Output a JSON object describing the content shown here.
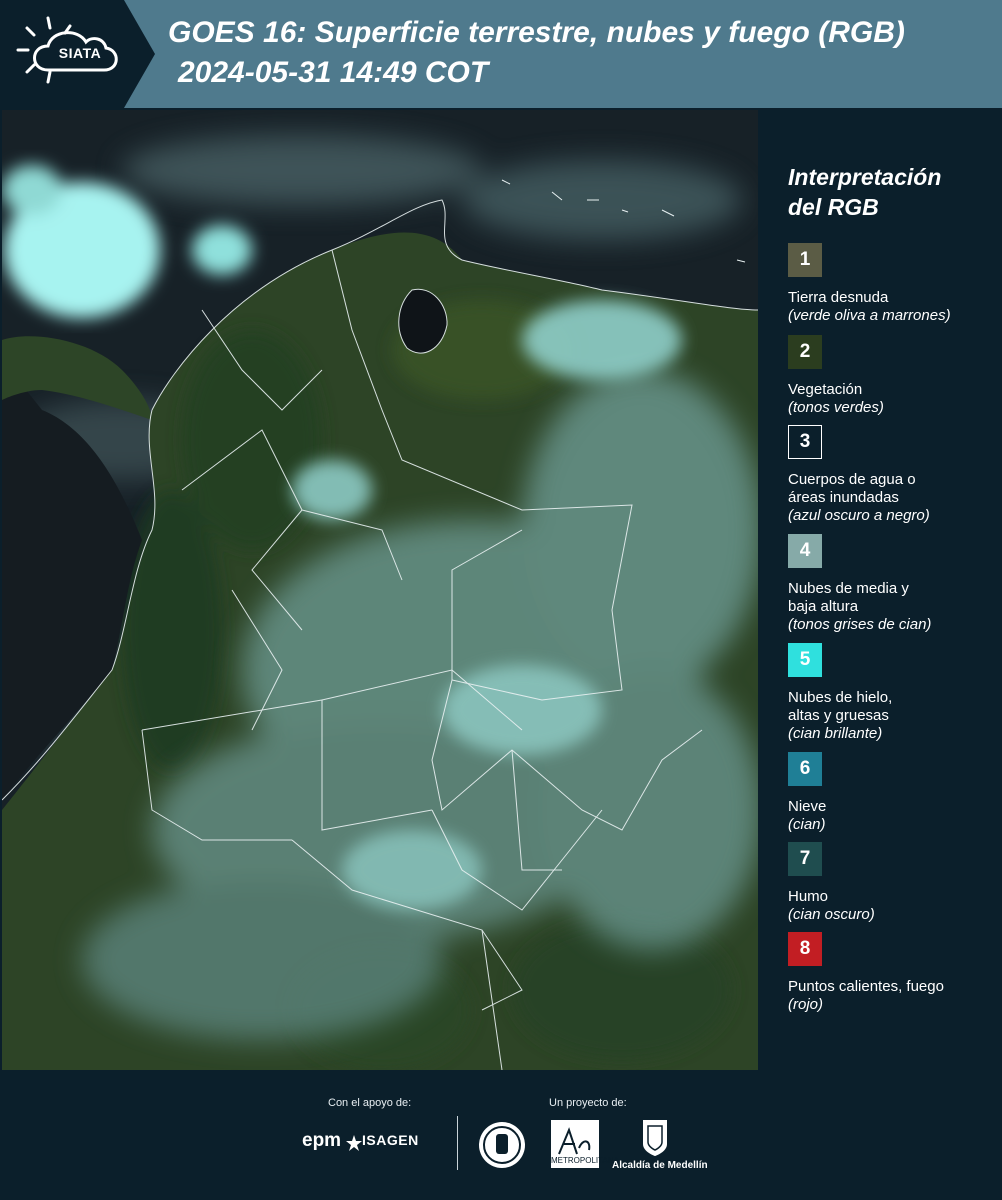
{
  "header": {
    "logo_text": "SIATA",
    "title": "GOES 16: Superficie terrestre, nubes y fuego (RGB)",
    "datetime": "2024-05-31 14:49 COT"
  },
  "legend": {
    "title_line1": "Interpretación",
    "title_line2": "del RGB",
    "items": [
      {
        "number": "1",
        "color": "#5b5c45",
        "label": "Tierra desnuda",
        "desc": "(verde oliva a marrones)"
      },
      {
        "number": "2",
        "color": "#2b3d1f",
        "label": "Vegetación",
        "desc": "(tonos verdes)"
      },
      {
        "number": "3",
        "color": "#0b1f2b",
        "label": "Cuerpos de agua o áreas inundadas",
        "desc": "(azul oscuro a negro)"
      },
      {
        "number": "4",
        "color": "#86aaa8",
        "label": "Nubes de media y baja altura",
        "desc": "(tonos grises de cian)"
      },
      {
        "number": "5",
        "color": "#2fe0de",
        "label": "Nubes de hielo, altas y gruesas",
        "desc": "(cian brillante)"
      },
      {
        "number": "6",
        "color": "#1f7f96",
        "label": "Nieve",
        "desc": "(cian)"
      },
      {
        "number": "7",
        "color": "#1f4d4f",
        "label": "Humo",
        "desc": "(cian oscuro)"
      },
      {
        "number": "8",
        "color": "#c21e23",
        "label": "Puntos calientes, fuego",
        "desc": "(rojo)"
      }
    ]
  },
  "footer": {
    "support_label": "Con el apoyo de:",
    "project_label": "Un proyecto de:",
    "epm": "epm",
    "isagen": "ISAGEN",
    "area_label": "METROPOLITANA",
    "alcaldia": "Alcaldía de Medellín"
  },
  "colors": {
    "header_bg": "#4f7a8d",
    "header_dark": "#0b1f2b",
    "page_bg": "#0b1f2b",
    "vegetation": "#2f4a24",
    "clouds": "#7fb8b6",
    "bright_clouds": "#9ff0ee",
    "water": "#10161c"
  }
}
